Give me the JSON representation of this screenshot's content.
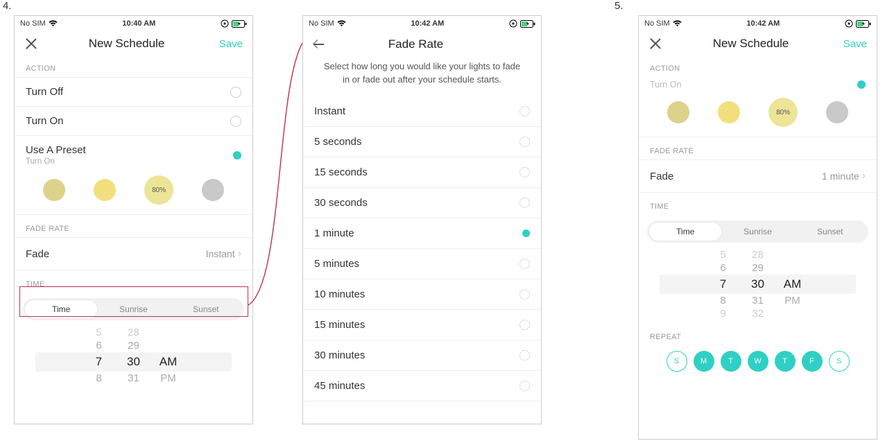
{
  "labels": {
    "step4": "4.",
    "step5": "5."
  },
  "status": {
    "carrier": "No SIM",
    "time1": "10:40 AM",
    "time2": "10:42 AM",
    "time3": "10:42 AM"
  },
  "screen1": {
    "title": "New Schedule",
    "save": "Save",
    "sections": {
      "action": "ACTION",
      "fade": "FADE RATE",
      "time": "TIME"
    },
    "actions": {
      "off": "Turn Off",
      "on": "Turn On",
      "preset": "Use A Preset",
      "preset_sub": "Turn On"
    },
    "preset_pct": "80%",
    "swatch_colors": [
      "#dcd28a",
      "#f3df7d",
      "#ece497",
      "#c9c9c9"
    ],
    "fade_label": "Fade",
    "fade_value": "Instant",
    "time_tabs": [
      "Time",
      "Sunrise",
      "Sunset"
    ],
    "picker": {
      "rows": [
        {
          "h": "5",
          "m": "28",
          "ampm": ""
        },
        {
          "h": "6",
          "m": "29",
          "ampm": ""
        },
        {
          "h": "7",
          "m": "30",
          "ampm": "AM"
        },
        {
          "h": "8",
          "m": "31",
          "ampm": "PM"
        }
      ],
      "selected_index": 2
    }
  },
  "screen2": {
    "title": "Fade Rate",
    "helper": "Select how long you would like your lights to fade in or fade out after your schedule starts.",
    "options": [
      "Instant",
      "5 seconds",
      "15 seconds",
      "30 seconds",
      "1 minute",
      "5 minutes",
      "10 minutes",
      "15 minutes",
      "30 minutes",
      "45 minutes"
    ],
    "selected": "1 minute"
  },
  "screen3": {
    "title": "New Schedule",
    "save": "Save",
    "sections": {
      "action": "ACTION",
      "fade": "FADE RATE",
      "time": "TIME",
      "repeat": "REPEAT"
    },
    "action_label": "Turn On",
    "preset_pct": "80%",
    "swatch_colors": [
      "#dcd28a",
      "#f3df7d",
      "#ece497",
      "#c9c9c9"
    ],
    "fade_label": "Fade",
    "fade_value": "1 minute",
    "time_tabs": [
      "Time",
      "Sunrise",
      "Sunset"
    ],
    "picker": {
      "rows": [
        {
          "h": "5",
          "m": "28",
          "ampm": ""
        },
        {
          "h": "6",
          "m": "29",
          "ampm": ""
        },
        {
          "h": "7",
          "m": "30",
          "ampm": "AM"
        },
        {
          "h": "8",
          "m": "31",
          "ampm": "PM"
        },
        {
          "h": "9",
          "m": "32",
          "ampm": ""
        }
      ],
      "selected_index": 2
    },
    "days": [
      {
        "l": "S",
        "on": false
      },
      {
        "l": "M",
        "on": true
      },
      {
        "l": "T",
        "on": true
      },
      {
        "l": "W",
        "on": true
      },
      {
        "l": "T",
        "on": true
      },
      {
        "l": "F",
        "on": true
      },
      {
        "l": "S",
        "on": false
      }
    ]
  }
}
